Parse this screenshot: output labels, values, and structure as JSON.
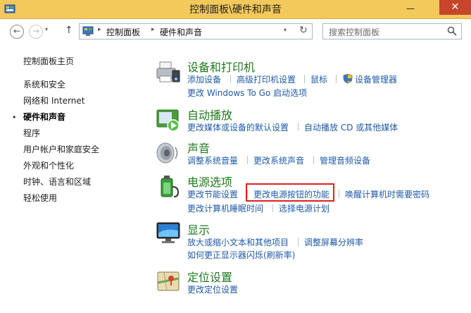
{
  "window": {
    "title": "控制面板\\硬件和声音",
    "minimize_glyph": "—",
    "close_glyph": "✕"
  },
  "toolbar": {
    "back_glyph": "←",
    "forward_glyph": "→",
    "history_glyph": "▾",
    "up_glyph": "↑",
    "refresh_glyph": "↻"
  },
  "address": {
    "crumbs": [
      "控制面板",
      "硬件和声音"
    ],
    "separator": "▸",
    "dropdown_glyph": "▾"
  },
  "search": {
    "placeholder": "搜索控制面板"
  },
  "sidebar": {
    "items": [
      {
        "label": "控制面板主页"
      },
      {
        "label": "系统和安全"
      },
      {
        "label": "网络和 Internet"
      },
      {
        "label": "硬件和声音"
      },
      {
        "label": "程序"
      },
      {
        "label": "用户帐户和家庭安全"
      },
      {
        "label": "外观和个性化"
      },
      {
        "label": "时钟、语言和区域"
      },
      {
        "label": "轻松使用"
      }
    ],
    "current_index": 3,
    "bullet_glyph": "•"
  },
  "categories": [
    {
      "title": "设备和打印机",
      "icon": "printer-icon",
      "links": [
        [
          "添加设备",
          "高级打印机设置",
          "鼠标",
          "设备管理器"
        ],
        [
          "更改 Windows To Go 启动选项"
        ]
      ]
    },
    {
      "title": "自动播放",
      "icon": "autoplay-icon",
      "links": [
        [
          "更改媒体或设备的默认设置",
          "自动播放 CD 或其他媒体"
        ]
      ]
    },
    {
      "title": "声音",
      "icon": "speaker-icon",
      "links": [
        [
          "调整系统音量",
          "更改系统声音",
          "管理音频设备"
        ]
      ]
    },
    {
      "title": "电源选项",
      "icon": "battery-icon",
      "links": [
        [
          "更改节能设置",
          "更改电源按钮的功能",
          "唤醒计算机时需要密码"
        ],
        [
          "更改计算机睡眠时间",
          "选择电源计划"
        ]
      ]
    },
    {
      "title": "显示",
      "icon": "monitor-icon",
      "links": [
        [
          "放大或缩小文本和其他项目",
          "调整屏幕分辨率"
        ],
        [
          "如何更正显示器闪烁(刷新率)"
        ]
      ]
    },
    {
      "title": "定位设置",
      "icon": "location-icon",
      "links": [
        [
          "更改定位设置"
        ]
      ]
    }
  ],
  "colors": {
    "titlebar": "#f2c95a",
    "category_title": "#1f7a1f",
    "link": "#1e5aa8",
    "highlight_box": "#e02020"
  }
}
